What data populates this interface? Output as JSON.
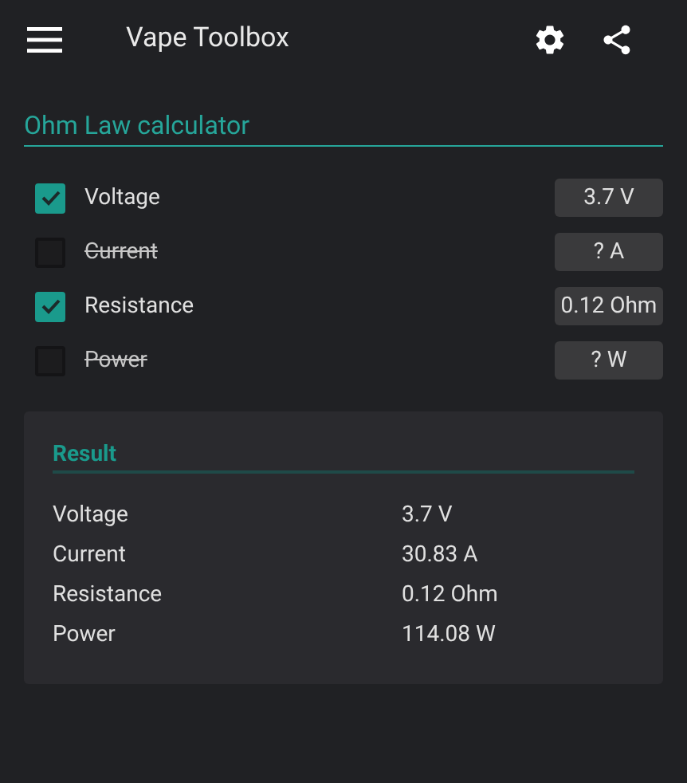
{
  "app_bar": {
    "title": "Vape Toolbox"
  },
  "section_title": "Ohm Law calculator",
  "inputs": [
    {
      "label": "Voltage",
      "checked": true,
      "value": "3.7 V"
    },
    {
      "label": "Current",
      "checked": false,
      "value": "? A"
    },
    {
      "label": "Resistance",
      "checked": true,
      "value": "0.12 Ohm"
    },
    {
      "label": "Power",
      "checked": false,
      "value": "? W"
    }
  ],
  "result": {
    "title": "Result",
    "rows": [
      {
        "label": "Voltage",
        "value": "3.7 V"
      },
      {
        "label": "Current",
        "value": "30.83 A"
      },
      {
        "label": "Resistance",
        "value": "0.12 Ohm"
      },
      {
        "label": "Power",
        "value": "114.08 W"
      }
    ]
  }
}
